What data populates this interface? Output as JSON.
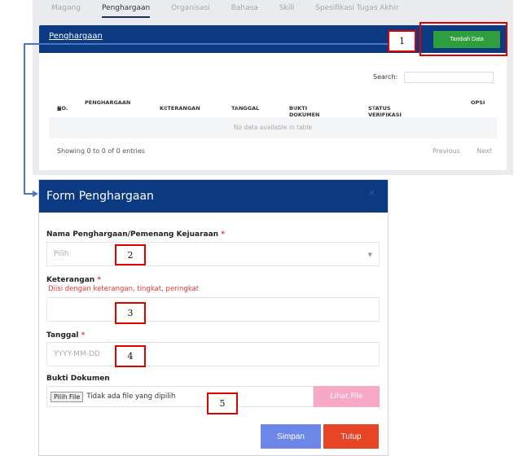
{
  "tabs": [
    "Magang",
    "Penghargaan",
    "Organisasi",
    "Bahasa",
    "Skill",
    "Spesifikasi Tugas Akhir"
  ],
  "active_tab": "Penghargaan",
  "card": {
    "title": "Penghargaan",
    "add_button": "Tambah Data",
    "search_label": "Search:",
    "columns": [
      "NO.",
      "PENGHARGAAN",
      "KETERANGAN",
      "TANGGAL",
      "BUKTI DOKUMEN",
      "STATUS VERIFIKASI",
      "OPSI"
    ],
    "empty_text": "No data available in table",
    "info": "Showing 0 to 0 of 0 entries",
    "prev": "Previous",
    "next": "Next"
  },
  "modal": {
    "title": "Form Penghargaan",
    "close": "×",
    "nama_label": "Nama Penghargaan/Pemenang Kejuaraan",
    "nama_placeholder": "Pilih",
    "keterangan_label": "Keterangan",
    "keterangan_hint": "Diisi dengan keterangan, tingkat, peringkat",
    "tanggal_label": "Tanggal",
    "tanggal_placeholder": "YYYY-MM-DD",
    "bukti_label": "Bukti Dokumen",
    "file_button": "Pilih File",
    "file_status": "Tidak ada file yang dipilih",
    "lihat_button": "Lihat File",
    "simpan": "Simpan",
    "tutup": "Tutup",
    "required_mark": "*"
  },
  "annotations": [
    "1",
    "2",
    "3",
    "4",
    "5"
  ],
  "colors": {
    "header": "#0b3a82",
    "add": "#2f9e3e",
    "lihat": "#f7a8c7",
    "simpan": "#6c87e8",
    "tutup": "#e84526",
    "annotation": "#e00000",
    "arrow": "#4a76c8"
  }
}
